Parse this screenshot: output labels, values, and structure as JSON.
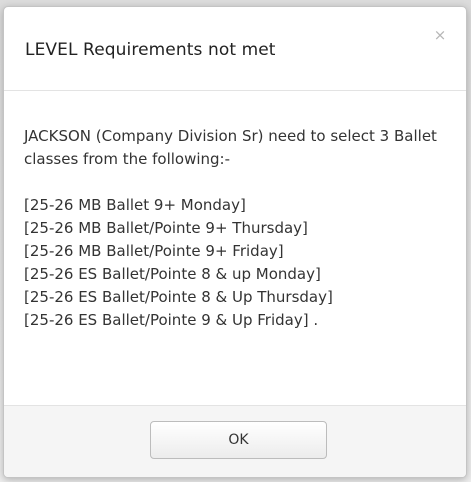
{
  "dialog": {
    "title": "LEVEL Requirements not met",
    "close_icon": "close-icon",
    "close_glyph": "×",
    "message": "JACKSON (Company Division Sr) need to select 3 Ballet classes from the following:-",
    "classes": [
      "[25-26 MB Ballet 9+ Monday]",
      "[25-26 MB Ballet/Pointe 9+ Thursday]",
      "[25-26 MB Ballet/Pointe 9+ Friday]",
      "[25-26 ES Ballet/Pointe 8 & up Monday]",
      "[25-26 ES Ballet/Pointe 8 & Up Thursday]",
      "[25-26 ES Ballet/Pointe 9 & Up Friday] ."
    ],
    "ok_label": "OK"
  },
  "colors": {
    "text": "#333333",
    "title": "#222222",
    "close": "#b6b6b6",
    "footer_bg": "#f5f5f5",
    "divider": "#e3e3e3"
  }
}
